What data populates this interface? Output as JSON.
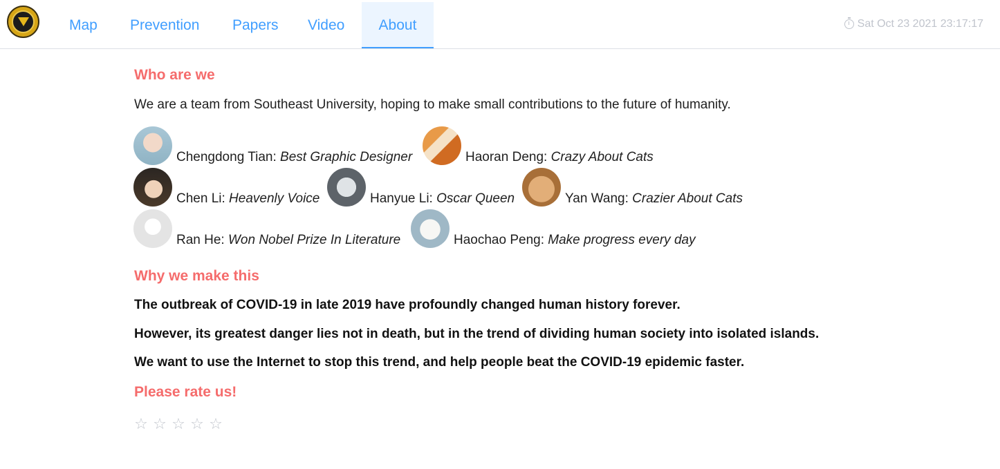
{
  "header": {
    "logo_name": "university-logo",
    "nav": [
      {
        "label": "Map"
      },
      {
        "label": "Prevention"
      },
      {
        "label": "Papers"
      },
      {
        "label": "Video"
      },
      {
        "label": "About"
      }
    ],
    "active_tab": "About",
    "clock_icon": "timer-icon",
    "datetime": "Sat Oct 23 2021 23:17:17"
  },
  "about": {
    "who_title": "Who are we",
    "intro": "We are a team from Southeast University, hoping to make small contributions to the future of humanity.",
    "members": [
      {
        "name": "Chengdong Tian: ",
        "role": "Best Graphic Designer"
      },
      {
        "name": "Haoran Deng: ",
        "role": "Crazy About Cats"
      },
      {
        "name": "Chen Li: ",
        "role": "Heavenly Voice"
      },
      {
        "name": "Hanyue Li: ",
        "role": "Oscar Queen"
      },
      {
        "name": "Yan Wang: ",
        "role": "Crazier About Cats"
      },
      {
        "name": "Ran He: ",
        "role": "Won Nobel Prize In Literature"
      },
      {
        "name": "Haochao Peng: ",
        "role": "Make progress every day"
      }
    ],
    "why_title": "Why we make this",
    "why_lines": [
      "The outbreak of COVID-19 in late 2019 have profoundly changed human history forever.",
      "However, its greatest danger lies not in death, but in the trend of dividing human society into isolated islands.",
      "We want to use the Internet to stop this trend, and help people beat the COVID-19 epidemic faster."
    ],
    "rate_title": "Please rate us!",
    "rating": {
      "value": 0,
      "max": 5,
      "star_glyph": "☆"
    }
  },
  "colors": {
    "accent": "#409eff",
    "heading": "#f56c6c",
    "muted": "#c0c4cc"
  }
}
